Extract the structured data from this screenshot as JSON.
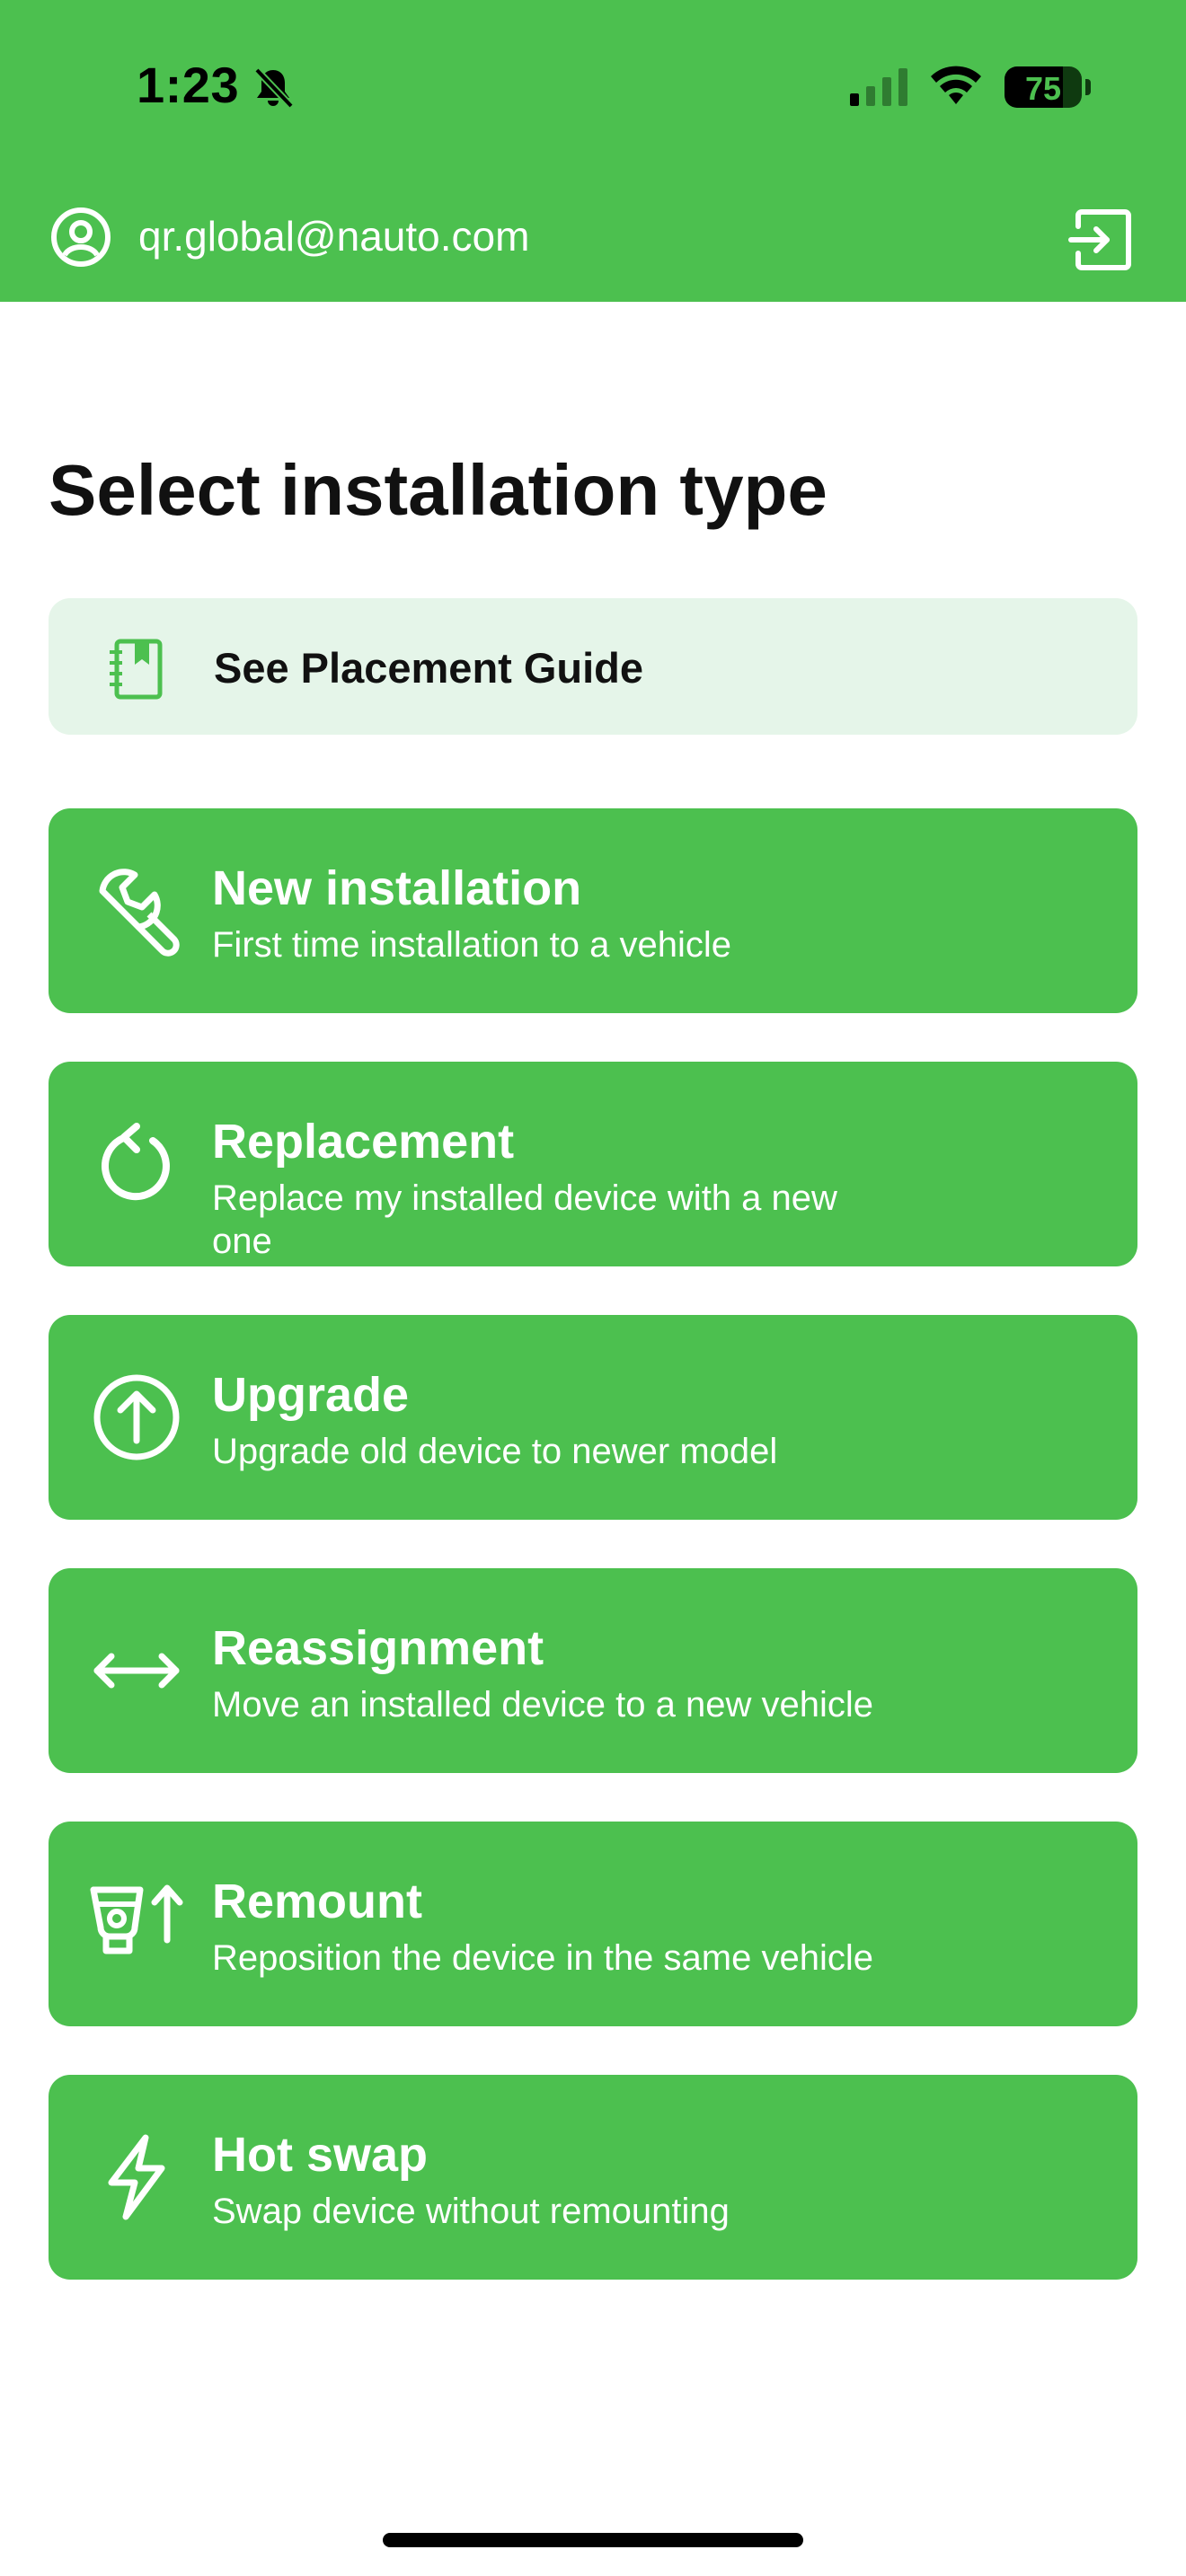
{
  "status_bar": {
    "time": "1:23",
    "battery": "75",
    "battery_level_percent": 75,
    "icons": [
      "bell-slash-icon",
      "cellular-signal-icon",
      "wifi-icon",
      "battery-icon"
    ]
  },
  "header": {
    "email": "qr.global@nauto.com",
    "account_icon": "user-circle-icon",
    "logout_icon": "logout-icon",
    "background_color": "#4cc04f"
  },
  "page": {
    "title": "Select installation type"
  },
  "placement_guide": {
    "label": "See Placement Guide",
    "icon": "notebook-icon",
    "background_color": "#e5f5e9"
  },
  "options": [
    {
      "title": "New installation",
      "description": "First time installation to a vehicle",
      "icon": "wrench-icon"
    },
    {
      "title": "Replacement",
      "description": "Replace my installed device with a new one",
      "icon": "rotate-icon"
    },
    {
      "title": "Upgrade",
      "description": "Upgrade old device to newer model",
      "icon": "arrow-up-circle-icon"
    },
    {
      "title": "Reassignment",
      "description": "Move an installed device to a new vehicle",
      "icon": "horizontal-arrows-icon"
    },
    {
      "title": "Remount",
      "description": "Reposition the device in the same vehicle",
      "icon": "remount-device-icon"
    },
    {
      "title": "Hot swap",
      "description": "Swap device without remounting",
      "icon": "lightning-icon"
    }
  ],
  "colors": {
    "accent": "#4cc04f",
    "text_on_accent": "#ffffff"
  }
}
